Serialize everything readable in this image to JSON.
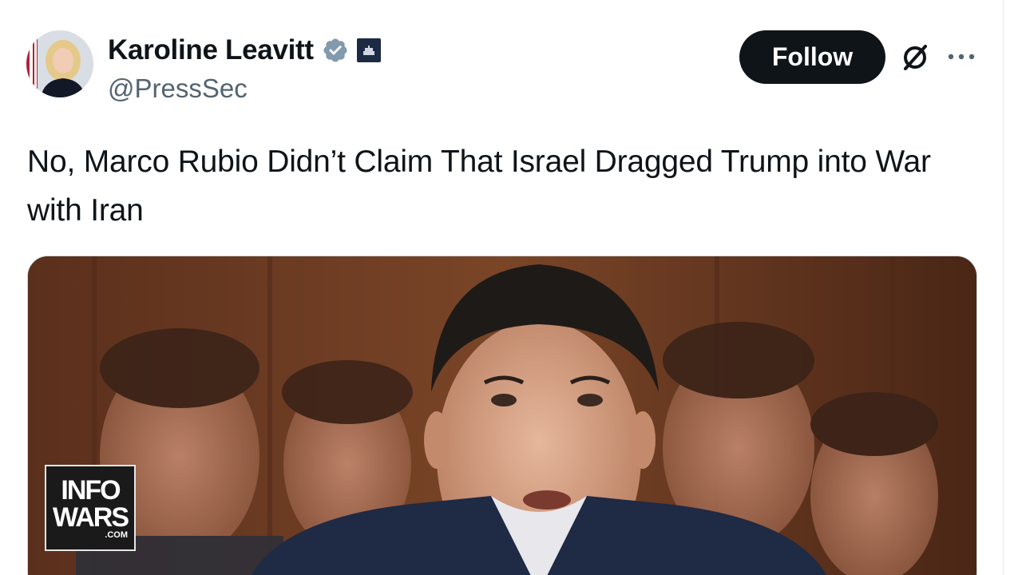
{
  "author": {
    "display_name": "Karoline Leavitt",
    "handle": "@PressSec",
    "verified_icon": "verified-check-icon",
    "affiliation_icon": "white-house-badge-icon"
  },
  "actions": {
    "follow_label": "Follow",
    "grok_icon": "grok-icon",
    "more_icon": "more-options-icon"
  },
  "tweet": {
    "text": "No, Marco Rubio Didn’t Claim That Israel Dragged Trump into War with Iran"
  },
  "media": {
    "watermark_line1": "INFO",
    "watermark_line2": "WARS",
    "watermark_line3": ".COM"
  },
  "colors": {
    "follow_bg": "#0f1419",
    "verified": "#829aab",
    "handle": "#536471"
  }
}
